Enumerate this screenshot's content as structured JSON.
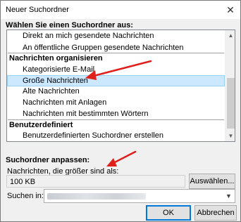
{
  "window": {
    "title": "Neuer Suchordner",
    "close_glyph": "✕"
  },
  "folder_list": {
    "header": "Wählen Sie einen Suchordner aus:",
    "rows": [
      {
        "type": "item",
        "label": "Direkt an mich gesendete Nachrichten"
      },
      {
        "type": "item",
        "label": "An öffentliche Gruppen gesendete Nachrichten"
      },
      {
        "type": "group",
        "label": "Nachrichten organisieren"
      },
      {
        "type": "item",
        "label": "Kategorisierte E-Mail"
      },
      {
        "type": "item",
        "label": "Große Nachrichten",
        "selected": true
      },
      {
        "type": "item",
        "label": "Alte Nachrichten"
      },
      {
        "type": "item",
        "label": "Nachrichten mit Anlagen"
      },
      {
        "type": "item",
        "label": "Nachrichten mit bestimmten Wörtern"
      },
      {
        "type": "group",
        "label": "Benutzerdefiniert"
      },
      {
        "type": "item",
        "label": "Benutzerdefinierten Suchordner erstellen"
      }
    ],
    "scroll_up_glyph": "▲",
    "scroll_down_glyph": "▼"
  },
  "customize": {
    "header": "Suchordner anpassen:",
    "size_label": "Nachrichten, die größer sind als:",
    "size_value": "100 KB",
    "choose_button": "Auswählen...",
    "search_in_label": "Suchen in:",
    "combo_arrow_glyph": "▼"
  },
  "buttons": {
    "ok": "OK",
    "cancel": "Abbrechen"
  },
  "colors": {
    "selection_bg": "#cce8ff",
    "annotation_arrow": "#e0201b",
    "default_button_border": "#0078d7"
  },
  "icons": {
    "close": "close-icon",
    "scroll_up": "chevron-up-icon",
    "scroll_down": "chevron-down-icon",
    "combo_dropdown": "chevron-down-icon",
    "annotation": "red-arrow-annotation"
  }
}
